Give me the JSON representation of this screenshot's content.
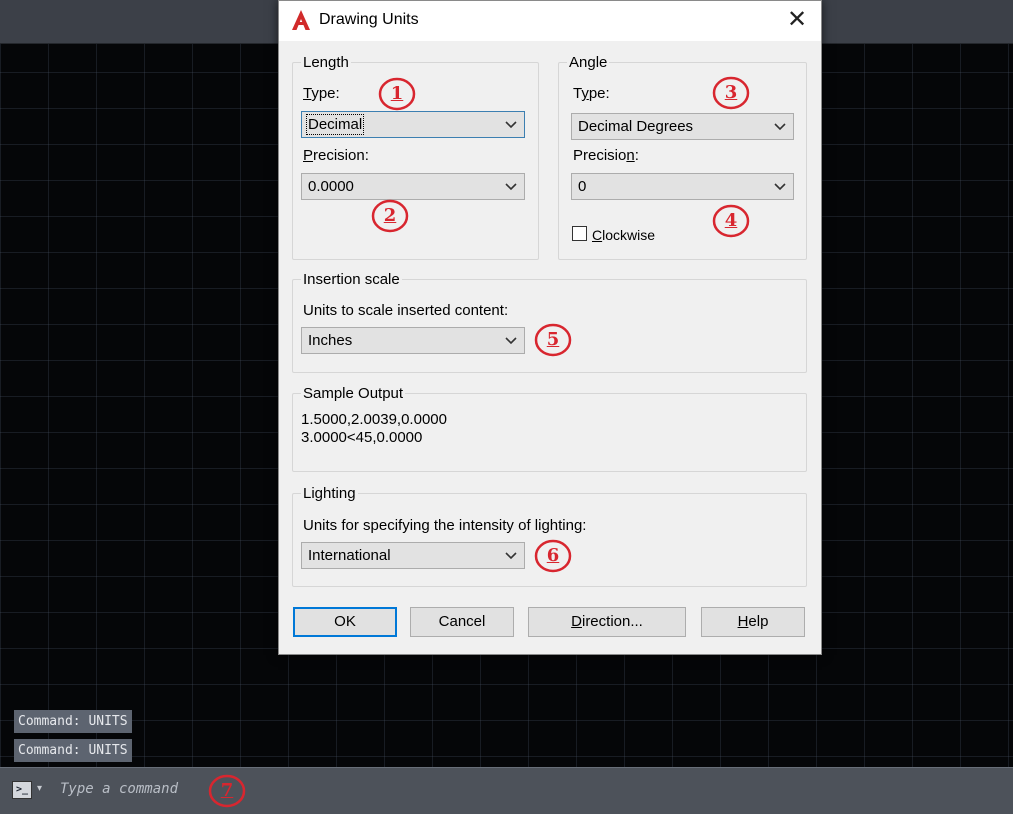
{
  "dialog": {
    "title": "Drawing Units",
    "close_glyph": "✕",
    "app_icon": "autocad-logo-icon"
  },
  "length": {
    "group_label": "Length",
    "type_label_u": "T",
    "type_label_rest": "ype:",
    "type_value": "Decimal",
    "precision_label_u": "P",
    "precision_label_rest": "recision:",
    "precision_value": "0.0000"
  },
  "angle": {
    "group_label": "Angle",
    "type_label_pre": "T",
    "type_label_u": "y",
    "type_label_rest": "pe:",
    "type_value": "Decimal Degrees",
    "precision_label_pre": "Precisio",
    "precision_label_u": "n",
    "precision_label_rest": ":",
    "precision_value": "0",
    "clockwise_label_u": "C",
    "clockwise_label_rest": "lockwise",
    "clockwise_checked": false
  },
  "insertion": {
    "group_label": "Insertion scale",
    "caption": "Units to scale inserted content:",
    "value": "Inches"
  },
  "sample": {
    "group_label": "Sample Output",
    "line1": "1.5000,2.0039,0.0000",
    "line2": "3.0000<45,0.0000"
  },
  "lighting": {
    "group_label": "Lighting",
    "caption": "Units for specifying the intensity of lighting:",
    "value": "International"
  },
  "buttons": {
    "ok": "OK",
    "cancel": "Cancel",
    "direction_u": "D",
    "direction_rest": "irection...",
    "help_u": "H",
    "help_rest": "elp"
  },
  "annotations": {
    "n1": "1",
    "n2": "2",
    "n3": "3",
    "n4": "4",
    "n5": "5",
    "n6": "6",
    "n7": "7",
    "color": "#d8262f"
  },
  "command_line": {
    "history": [
      "Command: UNITS",
      "Command: UNITS"
    ],
    "placeholder": "Type a command",
    "icon_glyph": ">_",
    "arrow_glyph": "▾"
  },
  "colors": {
    "canvas": "#050608",
    "dialog_bg": "#f0f0f0",
    "accent": "#0078d7",
    "autocad_red": "#d12a2a"
  }
}
